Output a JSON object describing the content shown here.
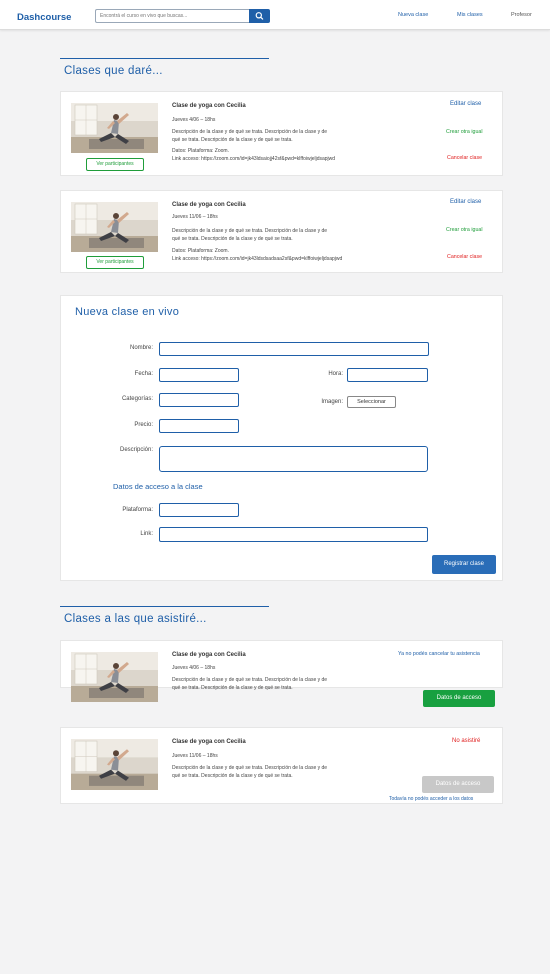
{
  "header": {
    "brand": "Dashcourse",
    "search_placeholder": "Encontrá el curso en vivo que buscas...",
    "nav": {
      "nueva_clase": "Nueva clase",
      "mis_clases": "Mis clases",
      "profesor": "Profesor"
    }
  },
  "teaching": {
    "title": "Clases que daré...",
    "classes": [
      {
        "title": "Clase de yoga con Cecilia",
        "date": "Jueves 4/06 – 18hs",
        "desc1": "Descripción de la clase y de qué se trata. Descripción de la clase y de",
        "desc2": "qué se trata. Descripción de la clase y de qué se trata.",
        "datos": "Datos: Plataforma: Zoom.",
        "link": "Link acceso: https://zoom.com/id=jk43ldsaiojj42sf&pwd=klffoiwjeljdsapjwd",
        "participants": "Ver participantes",
        "edit": "Editar clase",
        "create": "Crear otra igual",
        "cancel": "Cancelar clase"
      },
      {
        "title": "Clase de yoga con Cecilia",
        "date": "Jueves 11/06 – 18hs",
        "desc1": "Descripción de la clase y de qué se trata. Descripción de la clase y de",
        "desc2": "qué se trata. Descripción de la clase y de qué se trata.",
        "datos": "Datos: Plataforma: Zoom.",
        "link": "Link acceso: https://zoom.com/id=jk43ldsdsadsaa2sf&pwd=klffoiwjeljdsapjwd",
        "participants": "Ver participantes",
        "edit": "Editar clase",
        "create": "Crear otra igual",
        "cancel": "Cancelar clase"
      }
    ]
  },
  "form": {
    "title": "Nueva clase en vivo",
    "labels": {
      "nombre": "Nombre:",
      "fecha": "Fecha:",
      "hora": "Hora:",
      "categorias": "Categorías:",
      "imagen": "Imagen:",
      "precio": "Precio:",
      "descripcion": "Descripción:",
      "plataforma": "Plataforma:",
      "link": "Link:"
    },
    "select_label": "Seleccionar",
    "access_title": "Datos de acceso a la clase",
    "submit": "Registrar clase"
  },
  "attending": {
    "title": "Clases a las que asistiré...",
    "classes": [
      {
        "title": "Clase de yoga con Cecilia",
        "date": "Jueves 4/06 – 18hs",
        "desc1": "Descripción de la clase y de qué se trata. Descripción de la clase y de",
        "desc2": "qué se trata. Descripción de la clase y de qué se trata.",
        "note": "Ya no podés cancelar tu asistencia",
        "button": "Datos de acceso"
      },
      {
        "title": "Clase de yoga con Cecilia",
        "date": "Jueves 11/06 – 18hs",
        "desc1": "Descripción de la clase y de qué se trata. Descripción de la clase y de",
        "desc2": "qué se trata. Descripción de la clase y de qué se trata.",
        "note": "No asistiré",
        "button": "Datos de acceso",
        "footnote": "Todavía no podés acceder a los datos"
      }
    ]
  },
  "colors": {
    "brand_blue": "#1f5fa8",
    "green": "#1f9d3a",
    "red": "#e02020",
    "disabled": "#c8c8c8"
  }
}
